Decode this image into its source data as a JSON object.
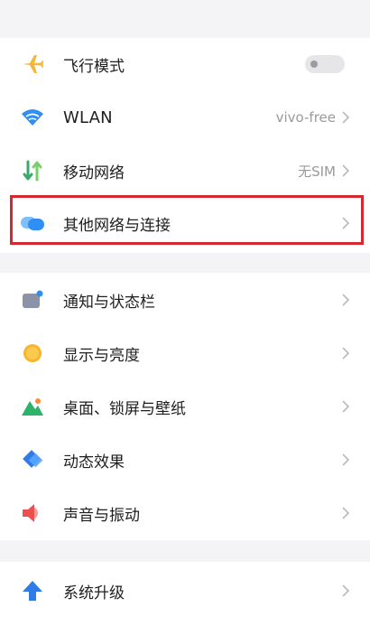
{
  "network": {
    "airplane": {
      "label": "飞行模式",
      "toggle_on": false
    },
    "wlan": {
      "label": "WLAN",
      "value": "vivo-free"
    },
    "mobile": {
      "label": "移动网络",
      "value": "无SIM"
    },
    "other": {
      "label": "其他网络与连接"
    }
  },
  "display": {
    "notification": {
      "label": "通知与状态栏"
    },
    "brightness": {
      "label": "显示与亮度"
    },
    "wallpaper": {
      "label": "桌面、锁屏与壁纸"
    },
    "animation": {
      "label": "动态效果"
    },
    "sound": {
      "label": "声音与振动"
    }
  },
  "system": {
    "upgrade": {
      "label": "系统升级"
    }
  },
  "colors": {
    "highlight_border": "#d7282f",
    "airplane_icon": "#f5b63a",
    "wlan_icon": "#2f8ff2",
    "mobile_icon": "#3aa86b",
    "other_icon": "#2f8ff2",
    "sun_icon": "#f7b52c",
    "wallpaper_icon": "#2bb36a",
    "animation_icon": "#2f7be8",
    "sound_icon": "#ef4f4f",
    "upgrade_icon": "#2f7be8"
  }
}
